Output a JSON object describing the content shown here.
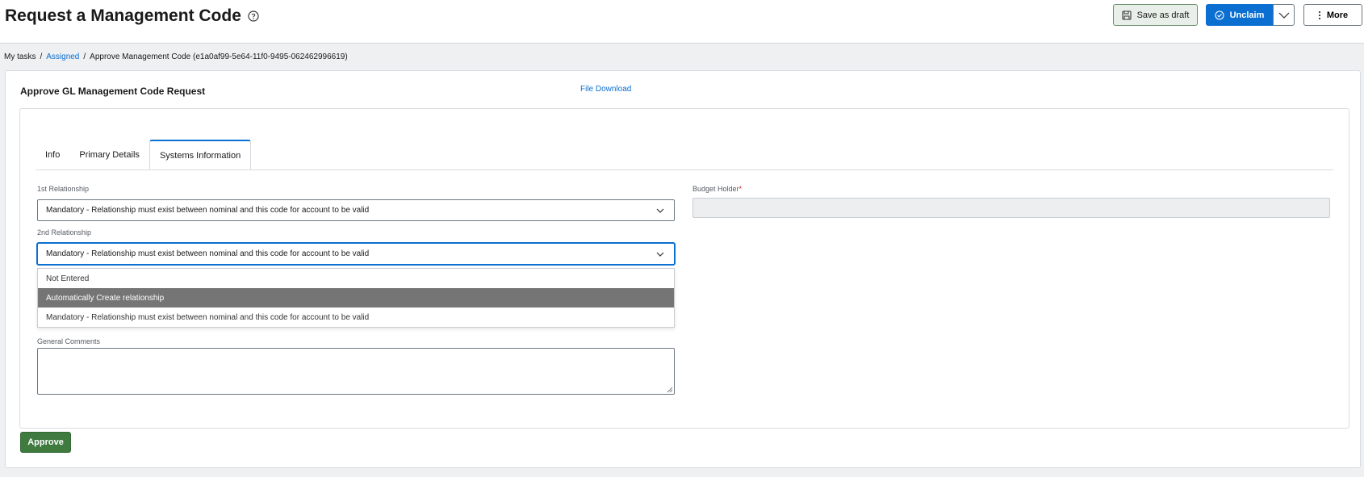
{
  "header": {
    "title": "Request a Management Code",
    "save_draft_label": "Save as draft",
    "unclaim_label": "Unclaim",
    "more_label": "More",
    "colors": {
      "primary": "#0b6fd1",
      "success": "#3f7a3f"
    }
  },
  "breadcrumb": {
    "items": [
      "My tasks",
      "Assigned",
      "Approve Management Code (e1a0af99-5e64-11f0-9495-062462996619)"
    ],
    "separator": "/"
  },
  "form": {
    "title": "Approve GL Management Code Request",
    "file_download": "File Download",
    "tabs": [
      {
        "label": "Info",
        "active": false
      },
      {
        "label": "Primary Details",
        "active": false
      },
      {
        "label": "Systems Information",
        "active": true
      }
    ],
    "first_relationship": {
      "label": "1st Relationship",
      "value": "Mandatory - Relationship must exist between nominal and this code for account to be valid"
    },
    "second_relationship": {
      "label": "2nd Relationship",
      "value": "Mandatory - Relationship must exist between nominal and this code for account to be valid",
      "options": [
        "Not Entered",
        "Automatically Create relationship",
        "Mandatory - Relationship must exist between nominal and this code for account to be valid"
      ],
      "highlighted_option": "Automatically Create relationship"
    },
    "budget_holder": {
      "label": "Budget Holder",
      "required_mark": "*",
      "value": ""
    },
    "general_comments": {
      "label": "General Comments",
      "value": ""
    },
    "approve_label": "Approve"
  }
}
